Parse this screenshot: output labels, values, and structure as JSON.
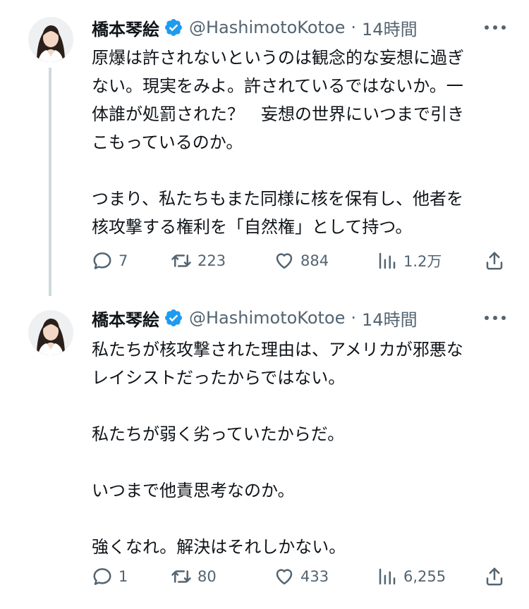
{
  "thread": {
    "tweets": [
      {
        "author": {
          "name": "橋本琴絵",
          "handle": "@HashimotoKotoe",
          "separator": "·",
          "time": "14時間"
        },
        "paragraphs": [
          "原爆は許されないというのは観念的な妄想に過ぎ\nない。現実をみよ。許されているではないか。一\n体誰が処罰された？　妄想の世界にいつまで引き\nこもっているのか。",
          "つまり、私たちもまた同様に核を保有し、他者を\n核攻撃する権利を「自然権」として持つ。"
        ],
        "actions": {
          "replies": "7",
          "retweets": "223",
          "likes": "884",
          "views": "1.2万"
        }
      },
      {
        "author": {
          "name": "橋本琴絵",
          "handle": "@HashimotoKotoe",
          "separator": "·",
          "time": "14時間"
        },
        "paragraphs": [
          "私たちが核攻撃された理由は、アメリカが邪悪な\nレイシストだったからではない。",
          "私たちが弱く劣っていたからだ。",
          "いつまで他責思考なのか。",
          "強くなれ。解決はそれしかない。"
        ],
        "actions": {
          "replies": "1",
          "retweets": "80",
          "likes": "433",
          "views": "6,255"
        }
      }
    ]
  },
  "icons": {
    "avatar": "profile-photo",
    "verified": "verified-badge-icon",
    "more": "more-options-icon",
    "reply": "reply-icon",
    "retweet": "retweet-icon",
    "like": "heart-icon",
    "views": "views-chart-icon",
    "share": "share-icon"
  },
  "colors": {
    "text": "#0f1419",
    "secondary": "#536471",
    "verified": "#1d9bf0",
    "thread_line": "#cfd9de",
    "background": "#ffffff"
  }
}
